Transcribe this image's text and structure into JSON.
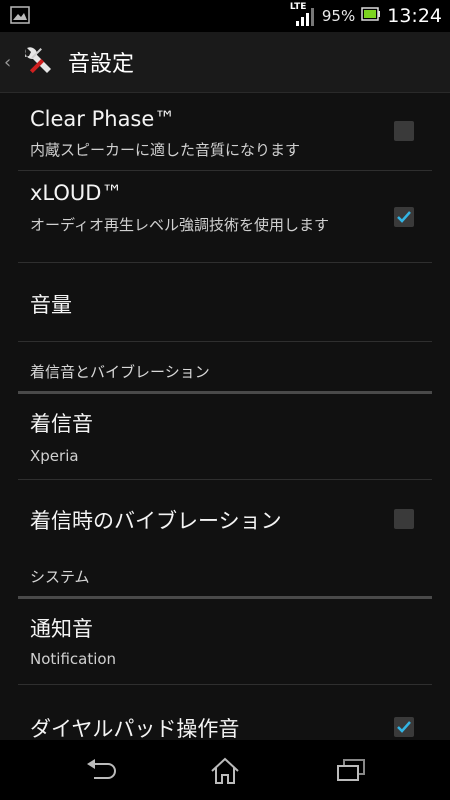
{
  "status_bar": {
    "network": "LTE",
    "battery": "95%",
    "time": "13:24",
    "icons": [
      "gallery-notification-icon",
      "signal-icon",
      "battery-icon"
    ]
  },
  "action_bar": {
    "title": "音設定",
    "icon": "tools-icon"
  },
  "settings": {
    "clear_phase": {
      "title": "Clear Phase™",
      "subtitle": "内蔵スピーカーに適した音質になります",
      "checked": false
    },
    "xloud": {
      "title": "xLOUD™",
      "subtitle": "オーディオ再生レベル強調技術を使用します",
      "checked": true
    },
    "volume": {
      "title": "音量"
    },
    "ringtone_section": "着信音とバイブレーション",
    "ringtone": {
      "title": "着信音",
      "subtitle": "Xperia"
    },
    "vibrate_on_ring": {
      "title": "着信時のバイブレーション",
      "checked": false
    },
    "system_section": "システム",
    "notification_sound": {
      "title": "通知音",
      "subtitle": "Notification"
    },
    "dialpad_tones": {
      "title": "ダイヤルパッド操作音",
      "checked": true
    }
  },
  "colors": {
    "accent": "#33b5e5",
    "background": "#111111"
  },
  "nav_bar": {
    "buttons": [
      "back-icon",
      "home-icon",
      "recent-apps-icon"
    ]
  }
}
